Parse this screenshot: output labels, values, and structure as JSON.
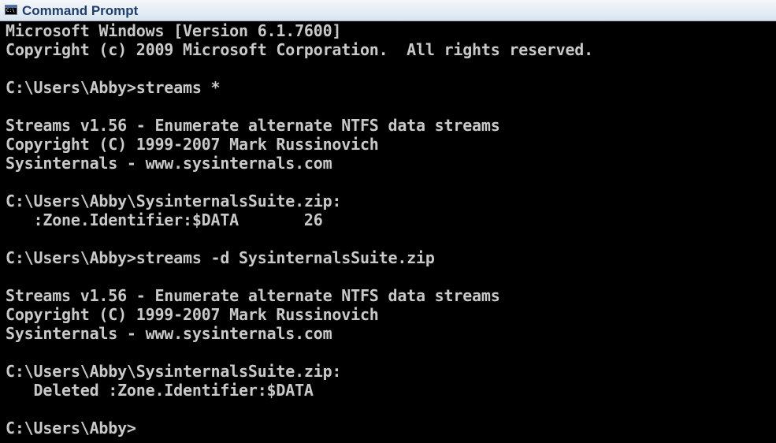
{
  "window": {
    "title": "Command Prompt",
    "icon": "console-app-icon",
    "icon_text": "C:\\",
    "colors": {
      "titlebar": "#e6edf5",
      "title_text": "#1f3f6b",
      "console_bg": "#000000",
      "console_text": "#c9c9c9"
    }
  },
  "console": {
    "lines": [
      "Microsoft Windows [Version 6.1.7600]",
      "Copyright (c) 2009 Microsoft Corporation.  All rights reserved.",
      "",
      "C:\\Users\\Abby>streams *",
      "",
      "Streams v1.56 - Enumerate alternate NTFS data streams",
      "Copyright (C) 1999-2007 Mark Russinovich",
      "Sysinternals - www.sysinternals.com",
      "",
      "C:\\Users\\Abby\\SysinternalsSuite.zip:",
      "   :Zone.Identifier:$DATA       26",
      "",
      "C:\\Users\\Abby>streams -d SysinternalsSuite.zip",
      "",
      "Streams v1.56 - Enumerate alternate NTFS data streams",
      "Copyright (C) 1999-2007 Mark Russinovich",
      "Sysinternals - www.sysinternals.com",
      "",
      "C:\\Users\\Abby\\SysinternalsSuite.zip:",
      "   Deleted :Zone.Identifier:$DATA",
      "",
      "C:\\Users\\Abby>"
    ]
  }
}
